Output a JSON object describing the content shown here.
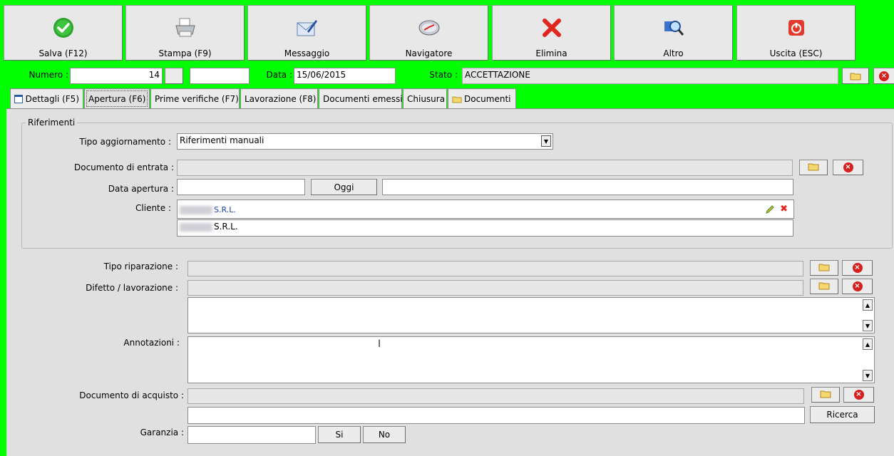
{
  "toolbar": [
    {
      "label": "Salva (F12)",
      "icon": "check-icon"
    },
    {
      "label": "Stampa (F9)",
      "icon": "printer-icon"
    },
    {
      "label": "Messaggio",
      "icon": "envelope-pen-icon"
    },
    {
      "label": "Navigatore",
      "icon": "compass-icon"
    },
    {
      "label": "Elimina",
      "icon": "red-x-icon"
    },
    {
      "label": "Altro",
      "icon": "magnifier-icon"
    },
    {
      "label": "Uscita (ESC)",
      "icon": "power-icon"
    }
  ],
  "header": {
    "numero_label": "Numero :",
    "numero_value": "14",
    "data_label": "Data :",
    "data_value": "15/06/2015",
    "stato_label": "Stato :",
    "stato_value": "ACCETTAZIONE"
  },
  "tabs": [
    {
      "label": "Dettagli (F5)",
      "icon": "calendar-icon"
    },
    {
      "label": "Apertura (F6)",
      "active": true
    },
    {
      "label": "Prime verifiche (F7)"
    },
    {
      "label": "Lavorazione (F8)"
    },
    {
      "label": "Documenti emessi"
    },
    {
      "label": "Chiusura"
    },
    {
      "label": "Documenti",
      "icon": "folder-icon"
    }
  ],
  "riferimenti": {
    "title": "Riferimenti",
    "tipo_label": "Tipo aggiornamento :",
    "tipo_value": "Riferimenti manuali",
    "doc_entrata_label": "Documento di entrata :",
    "data_apertura_label": "Data apertura :",
    "oggi_label": "Oggi",
    "cliente_label": "Cliente :",
    "cliente_link": "S.R.L.",
    "cliente_name": "S.R.L."
  },
  "details": {
    "tipo_riparazione_label": "Tipo riparazione :",
    "difetto_label": "Difetto / lavorazione :",
    "annotazioni_label": "Annotazioni :",
    "doc_acquisto_label": "Documento di acquisto :",
    "ricerca_label": "Ricerca",
    "garanzia_label": "Garanzia :",
    "si_label": "Si",
    "no_label": "No"
  },
  "colors": {
    "background": "#00ff00",
    "panel": "#e0e0e0",
    "accent_red": "#d61f1f"
  }
}
